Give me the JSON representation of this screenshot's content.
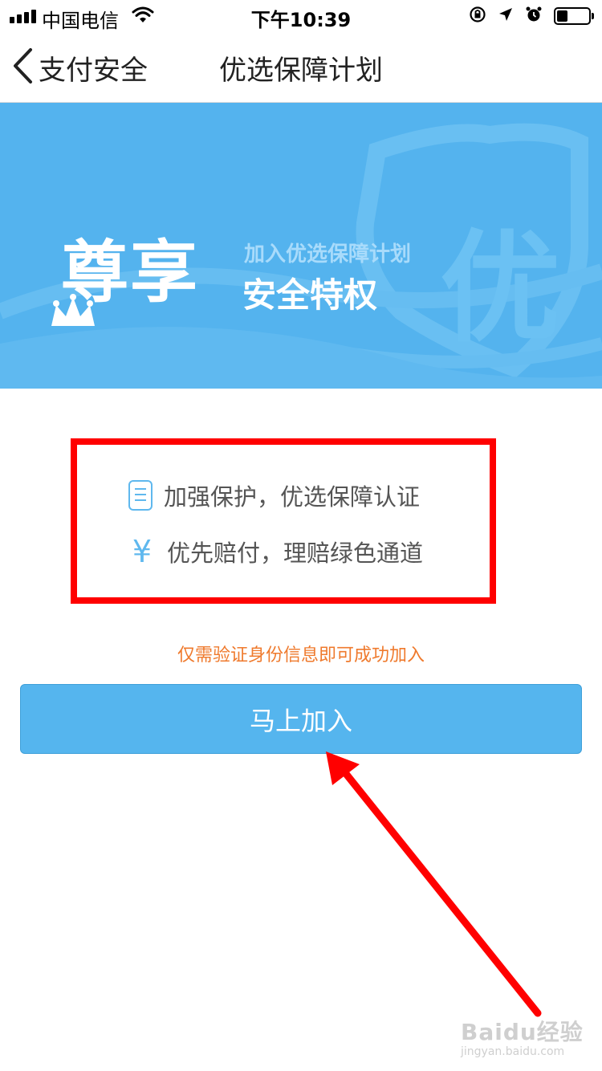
{
  "status_bar": {
    "carrier": "中国电信",
    "time": "下午10:39",
    "battery_level": 0.35
  },
  "nav": {
    "back_label": "支付安全",
    "title": "优选保障计划"
  },
  "banner": {
    "main_text": "尊享",
    "sub_text_1": "加入优选保障计划",
    "sub_text_2": "安全特权",
    "badge_char": "优",
    "background_color": "#54b3ee"
  },
  "features": [
    {
      "icon": "document-icon",
      "label": "加强保护，优选保障认证"
    },
    {
      "icon": "yen-icon",
      "label": "优先赔付，理赔绿色通道"
    }
  ],
  "hint": "仅需验证身份信息即可成功加入",
  "join_button_label": "马上加入",
  "colors": {
    "accent": "#55b5ee",
    "hint": "#ef7a2d",
    "annotation": "#ff0000"
  },
  "watermark": {
    "main": "Baidu经验",
    "url": "jingyan.baidu.com"
  }
}
